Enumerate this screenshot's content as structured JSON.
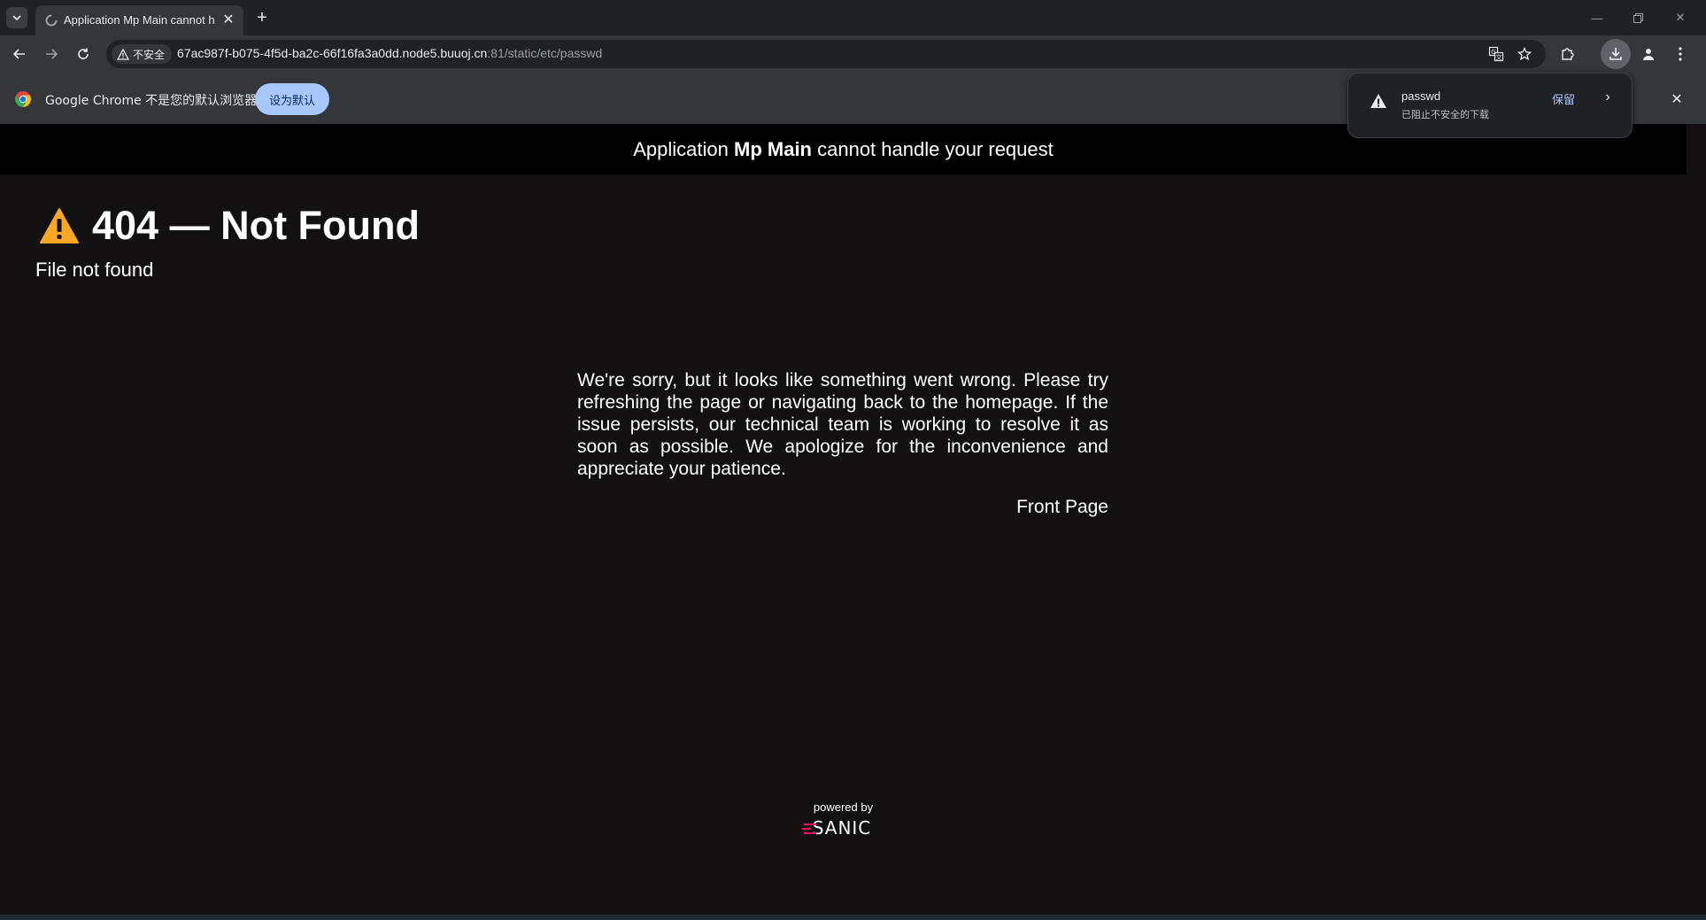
{
  "browser": {
    "tab": {
      "title": "Application Mp Main cannot handle your request"
    },
    "address": {
      "security_label": "不安全",
      "url_host": "67ac987f-b075-4f5d-ba2c-66f16fa3a0dd.node5.buuoj.cn",
      "url_path": ":81/static/etc/passwd"
    },
    "infobar": {
      "message": "Google Chrome 不是您的默认浏览器",
      "button_label": "设为默认"
    },
    "download": {
      "filename": "passwd",
      "status": "已阻止不安全的下载",
      "keep_label": "保留"
    },
    "colors": {
      "accent": "#a8c7fa",
      "warning": "#f9a825",
      "sanic": "#ff0d68"
    }
  },
  "page": {
    "header": {
      "prefix": "Application ",
      "app_name": "Mp Main",
      "suffix": " cannot handle your request"
    },
    "error_title": "404 — Not Found",
    "error_detail": "File not found",
    "apology": "We're sorry, but it looks like something went wrong. Please try refreshing the page or navigating back to the homepage. If the issue persists, our technical team is working to resolve it as soon as possible. We apologize for the inconvenience and appreciate your patience.",
    "front_page_link": "Front Page",
    "powered_by": "powered by",
    "logo_text": "SANIC"
  }
}
